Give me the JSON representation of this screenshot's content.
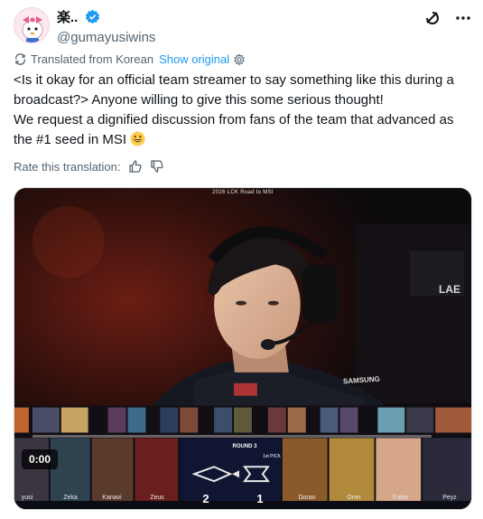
{
  "author": {
    "display_name": "楽..",
    "handle": "@gumayusiwins",
    "avatar": "pink-bow-character-avatar"
  },
  "header_icons": [
    "grok-icon",
    "more-options-icon"
  ],
  "translation": {
    "label": "Translated from Korean",
    "show_original": "Show original"
  },
  "tweet": {
    "line1": "<Is it okay for an official team streamer to say something like this during a broadcast?> Anyone willing to give this some serious thought!",
    "line2": "We request a dignified discussion from fans of the team that advanced as the #1 seed in MSI",
    "emoji": "grinning-face-emoji"
  },
  "rate": {
    "label": "Rate this translation:"
  },
  "video": {
    "broadcast_title": "2026 LCK Road to MSI",
    "timestamp": "0:00",
    "progress": 0.0,
    "jersey_text": "SAMSUNG",
    "banner_text": "LAE",
    "round_label": "ROUND 3",
    "pick_label": "1st PICK",
    "score_left": "2",
    "score_right": "1",
    "players_left": [
      "yusi",
      "Zeka",
      "Kanavi",
      "Zeus"
    ],
    "players_right": [
      "Doran",
      "Oner",
      "Faker",
      "Peyz"
    ],
    "colors": {
      "left_team": "#1b1d2a",
      "right_team": "#1b1d2a",
      "center_panel": "#101631"
    }
  }
}
